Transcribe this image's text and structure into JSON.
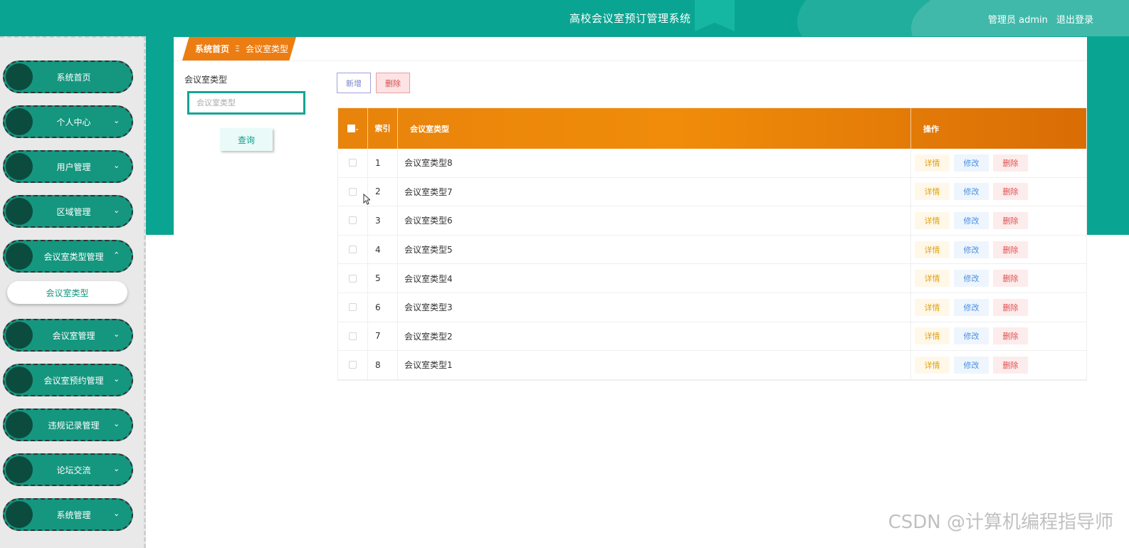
{
  "header": {
    "title": "高校会议室预订管理系统",
    "user_label": "管理员 admin",
    "logout": "退出登录"
  },
  "sidebar": {
    "items": [
      {
        "label": "系统首页",
        "chevron": ""
      },
      {
        "label": "个人中心",
        "chevron": "⌄"
      },
      {
        "label": "用户管理",
        "chevron": "⌄"
      },
      {
        "label": "区域管理",
        "chevron": "⌄"
      },
      {
        "label": "会议室类型管理",
        "chevron": "⌃"
      },
      {
        "label": "会议室管理",
        "chevron": "⌄"
      },
      {
        "label": "会议室预约管理",
        "chevron": "⌄"
      },
      {
        "label": "违规记录管理",
        "chevron": "⌄"
      },
      {
        "label": "论坛交流",
        "chevron": "⌄"
      },
      {
        "label": "系统管理",
        "chevron": "⌄"
      }
    ],
    "sub_item": "会议室类型"
  },
  "breadcrumb": {
    "home": "系统首页",
    "separator": "Ξ",
    "current": "会议室类型"
  },
  "search": {
    "label": "会议室类型",
    "placeholder": "会议室类型",
    "button": "查询"
  },
  "toolbar": {
    "add": "新增",
    "delete": "删除"
  },
  "table": {
    "headers": {
      "index": "索引",
      "name": "会议室类型",
      "ops": "操作"
    },
    "op_labels": {
      "detail": "详情",
      "edit": "修改",
      "remove": "删除"
    },
    "rows": [
      {
        "index": "1",
        "name": "会议室类型8"
      },
      {
        "index": "2",
        "name": "会议室类型7"
      },
      {
        "index": "3",
        "name": "会议室类型6"
      },
      {
        "index": "4",
        "name": "会议室类型5"
      },
      {
        "index": "5",
        "name": "会议室类型4"
      },
      {
        "index": "6",
        "name": "会议室类型3"
      },
      {
        "index": "7",
        "name": "会议室类型2"
      },
      {
        "index": "8",
        "name": "会议室类型1"
      }
    ]
  },
  "watermark": "CSDN @计算机编程指导师",
  "colors": {
    "brand_teal": "#0aa592",
    "header_orange": "#f08c0a"
  }
}
